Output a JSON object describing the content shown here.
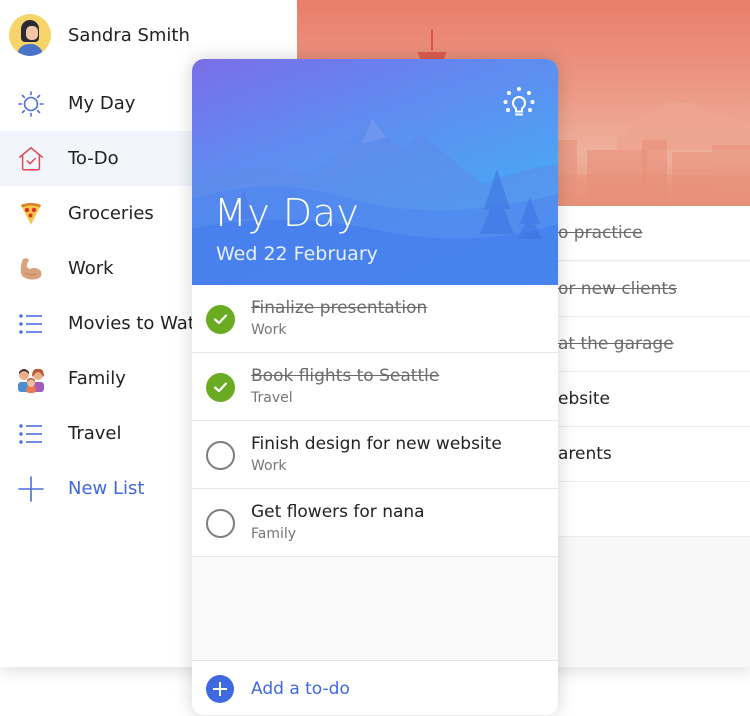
{
  "user": {
    "name": "Sandra Smith",
    "avatar_icon": "avatar-woman"
  },
  "sidebar": {
    "items": [
      {
        "label": "My Day",
        "icon": "sun-icon",
        "active": false
      },
      {
        "label": "To-Do",
        "icon": "home-check-icon",
        "active": true
      },
      {
        "label": "Groceries",
        "icon": "pizza-emoji-icon",
        "active": false
      },
      {
        "label": "Work",
        "icon": "flexed-biceps-emoji-icon",
        "active": false
      },
      {
        "label": "Movies to Watch",
        "icon": "list-icon",
        "active": false
      },
      {
        "label": "Family",
        "icon": "family-emoji-icon",
        "active": false
      },
      {
        "label": "Travel",
        "icon": "list-icon",
        "active": false
      }
    ],
    "new_list_label": "New List",
    "accent_color": "#3e69e0"
  },
  "background_list": {
    "rows": [
      {
        "text": "o practice",
        "done": true
      },
      {
        "text": "or new clients",
        "done": true
      },
      {
        "text": "at the garage",
        "done": true
      },
      {
        "text": "ebsite",
        "done": false
      },
      {
        "text": "arents",
        "done": false
      },
      {
        "text": "",
        "done": false
      }
    ]
  },
  "my_day": {
    "title": "My Day",
    "date": "Wed 22 February",
    "suggestions_icon": "lightbulb-icon",
    "tasks": [
      {
        "title": "Finalize presentation",
        "list": "Work",
        "done": true
      },
      {
        "title": "Book flights to Seattle",
        "list": "Travel",
        "done": true
      },
      {
        "title": "Finish design for new website",
        "list": "Work",
        "done": false
      },
      {
        "title": "Get flowers for nana",
        "list": "Family",
        "done": false
      }
    ],
    "add_label": "Add a to-do",
    "done_color": "#6aab22"
  }
}
